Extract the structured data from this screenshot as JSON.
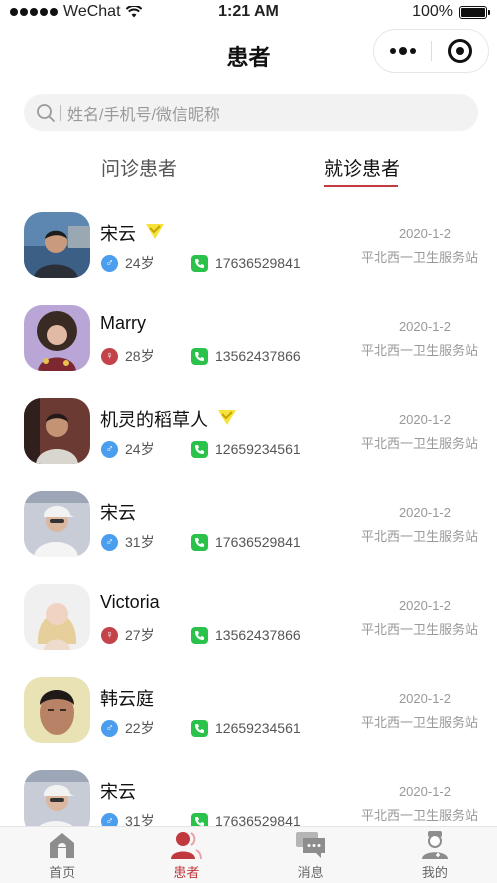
{
  "status_bar": {
    "carrier": "WeChat",
    "time": "1:21 AM",
    "battery": "100%"
  },
  "nav": {
    "title": "患者"
  },
  "search": {
    "placeholder": "姓名/手机号/微信昵称"
  },
  "tabs": [
    {
      "label": "问诊患者",
      "active": false
    },
    {
      "label": "就诊患者",
      "active": true
    }
  ],
  "patients": [
    {
      "name": "宋云",
      "vip": true,
      "sex": "male",
      "age": "24岁",
      "phone": "17636529841",
      "date": "2020-1-2",
      "station": "平北西一卫生服务站",
      "avatar": "man-lake"
    },
    {
      "name": "Marry",
      "vip": false,
      "sex": "female",
      "age": "28岁",
      "phone": "13562437866",
      "date": "2020-1-2",
      "station": "平北西一卫生服务站",
      "avatar": "woman-curly"
    },
    {
      "name": "机灵的稻草人",
      "vip": true,
      "sex": "male",
      "age": "24岁",
      "phone": "12659234561",
      "date": "2020-1-2",
      "station": "平北西一卫生服务站",
      "avatar": "man-dark"
    },
    {
      "name": "宋云",
      "vip": false,
      "sex": "male",
      "age": "31岁",
      "phone": "17636529841",
      "date": "2020-1-2",
      "station": "平北西一卫生服务站",
      "avatar": "man-cap"
    },
    {
      "name": "Victoria",
      "vip": false,
      "sex": "female",
      "age": "27岁",
      "phone": "13562437866",
      "date": "2020-1-2",
      "station": "平北西一卫生服务站",
      "avatar": "woman-blonde"
    },
    {
      "name": "韩云庭",
      "vip": false,
      "sex": "male",
      "age": "22岁",
      "phone": "12659234561",
      "date": "2020-1-2",
      "station": "平北西一卫生服务站",
      "avatar": "man-face"
    },
    {
      "name": "宋云",
      "vip": false,
      "sex": "male",
      "age": "31岁",
      "phone": "17636529841",
      "date": "2020-1-2",
      "station": "平北西一卫生服务站",
      "avatar": "man-cap"
    }
  ],
  "tabbar": [
    {
      "label": "首页",
      "icon": "home-icon",
      "active": false
    },
    {
      "label": "患者",
      "icon": "patient-icon",
      "active": true
    },
    {
      "label": "消息",
      "icon": "message-icon",
      "active": false
    },
    {
      "label": "我的",
      "icon": "doctor-icon",
      "active": false
    }
  ],
  "colors": {
    "accent": "#c33a3f",
    "male": "#4b9ded",
    "female": "#c3434a",
    "phone": "#2bc24c",
    "vip": "#f5e23a"
  }
}
